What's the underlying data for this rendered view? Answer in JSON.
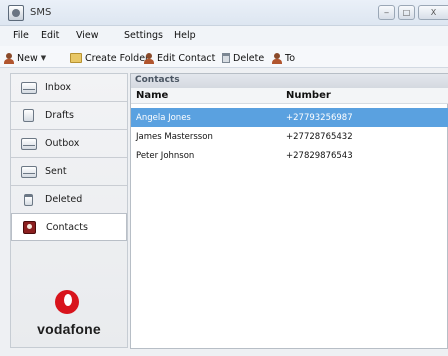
{
  "window": {
    "title": "SMS",
    "controls": {
      "minimize": "‒",
      "maximize": "□",
      "close": "X"
    }
  },
  "menu": [
    "File",
    "Edit",
    "View",
    "Settings",
    "Help"
  ],
  "toolbar": {
    "new_label": "New",
    "create_folder_label": "Create Folder",
    "edit_contact_label": "Edit Contact",
    "delete_label": "Delete",
    "to_label": "To"
  },
  "sidebar": {
    "items": [
      {
        "label": "Inbox",
        "icon": "inbox-icon"
      },
      {
        "label": "Drafts",
        "icon": "drafts-icon"
      },
      {
        "label": "Outbox",
        "icon": "outbox-icon"
      },
      {
        "label": "Sent",
        "icon": "sent-icon"
      },
      {
        "label": "Deleted",
        "icon": "trash-icon"
      },
      {
        "label": "Contacts",
        "icon": "contacts-icon",
        "active": true
      }
    ],
    "brand": "vodafone"
  },
  "contacts": {
    "panel_title": "Contacts",
    "columns": [
      "Name",
      "Number"
    ],
    "rows": [
      {
        "name": "Angela Jones",
        "number": "+27793256987",
        "selected": true
      },
      {
        "name": "James Mastersson",
        "number": "+27728765432",
        "selected": false
      },
      {
        "name": "Peter Johnson",
        "number": "+27829876543",
        "selected": false
      }
    ]
  },
  "colors": {
    "selection": "#5aa1e0",
    "brand": "#d8141c"
  }
}
